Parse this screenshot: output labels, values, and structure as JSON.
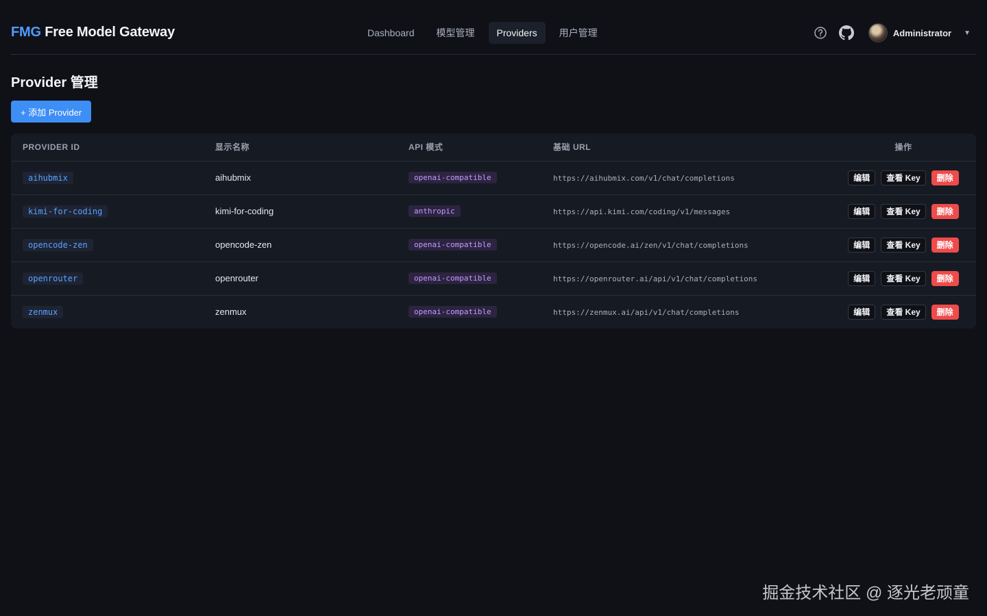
{
  "brand": {
    "accent": "FMG",
    "name": "Free Model Gateway"
  },
  "nav": {
    "items": [
      {
        "label": "Dashboard"
      },
      {
        "label": "模型管理"
      },
      {
        "label": "Providers"
      },
      {
        "label": "用户管理"
      }
    ],
    "active": "Providers"
  },
  "header": {
    "user_name": "Administrator",
    "icons": [
      "help-icon",
      "github-icon",
      "chevron-down-icon"
    ]
  },
  "page": {
    "title": "Provider 管理",
    "add_button": "+ 添加 Provider"
  },
  "table": {
    "columns": [
      "PROVIDER ID",
      "显示名称",
      "API 模式",
      "基础 URL",
      "操作"
    ],
    "rows": [
      {
        "id": "aihubmix",
        "name": "aihubmix",
        "mode": "openai-compatible",
        "url": "https://aihubmix.com/v1/chat/completions"
      },
      {
        "id": "kimi-for-coding",
        "name": "kimi-for-coding",
        "mode": "anthropic",
        "url": "https://api.kimi.com/coding/v1/messages"
      },
      {
        "id": "opencode-zen",
        "name": "opencode-zen",
        "mode": "openai-compatible",
        "url": "https://opencode.ai/zen/v1/chat/completions"
      },
      {
        "id": "openrouter",
        "name": "openrouter",
        "mode": "openai-compatible",
        "url": "https://openrouter.ai/api/v1/chat/completions"
      },
      {
        "id": "zenmux",
        "name": "zenmux",
        "mode": "openai-compatible",
        "url": "https://zenmux.ai/api/v1/chat/completions"
      }
    ],
    "actions": {
      "edit": "编辑",
      "view_key": "查看 Key",
      "delete": "删除"
    }
  },
  "watermark": "掘金技术社区 @ 逐光老顽童",
  "colors": {
    "accent": "#4f9dff",
    "primary_button": "#3d8ef5",
    "danger": "#ef4b4b",
    "mode_chip": "#c49cff"
  }
}
